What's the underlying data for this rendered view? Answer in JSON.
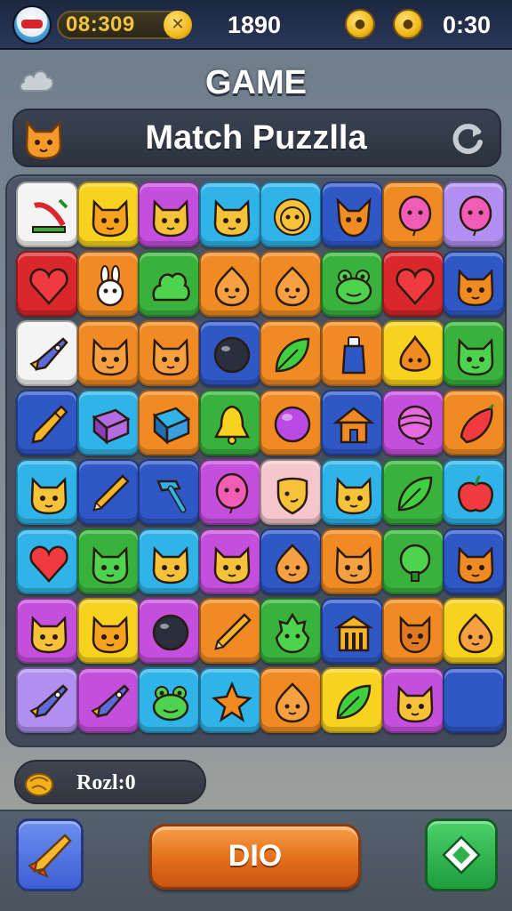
{
  "hud": {
    "coins": "08:309",
    "score": "1890",
    "timer": "0:30",
    "booster_1_icon": "gold-coin-icon",
    "booster_2_icon": "gold-coin-icon"
  },
  "header": {
    "title": "GAME",
    "subtitle": "Match Puzzlla"
  },
  "board": {
    "rows": 8,
    "cols": 8,
    "colors": {
      "white": "#f4f4f4",
      "yellow": "#f7d21f",
      "magenta": "#c44fdc",
      "cyan": "#2fb3e8",
      "blue": "#2f57c6",
      "orange": "#f08a22",
      "lavender": "#b08ff0",
      "red": "#d9272b",
      "green": "#38b23c",
      "pink": "#f5c6cb"
    },
    "tiles": [
      [
        {
          "c": "white",
          "i": "slide"
        },
        {
          "c": "yellow",
          "i": "cat"
        },
        {
          "c": "magenta",
          "i": "cat"
        },
        {
          "c": "cyan",
          "i": "cat"
        },
        {
          "c": "cyan",
          "i": "lion"
        },
        {
          "c": "blue",
          "i": "fox"
        },
        {
          "c": "orange",
          "i": "balloon"
        },
        {
          "c": "lavender",
          "i": "balloon"
        }
      ],
      [
        {
          "c": "red",
          "i": "heart"
        },
        {
          "c": "orange",
          "i": "bunny"
        },
        {
          "c": "green",
          "i": "bush"
        },
        {
          "c": "orange",
          "i": "blob"
        },
        {
          "c": "orange",
          "i": "blob"
        },
        {
          "c": "green",
          "i": "frog"
        },
        {
          "c": "red",
          "i": "heart"
        },
        {
          "c": "blue",
          "i": "cat"
        }
      ],
      [
        {
          "c": "white",
          "i": "rocket"
        },
        {
          "c": "orange",
          "i": "cat"
        },
        {
          "c": "orange",
          "i": "cat"
        },
        {
          "c": "blue",
          "i": "ball"
        },
        {
          "c": "orange",
          "i": "leaf"
        },
        {
          "c": "orange",
          "i": "bottle"
        },
        {
          "c": "yellow",
          "i": "onion"
        },
        {
          "c": "green",
          "i": "cat"
        }
      ],
      [
        {
          "c": "blue",
          "i": "crystal"
        },
        {
          "c": "cyan",
          "i": "book"
        },
        {
          "c": "orange",
          "i": "box"
        },
        {
          "c": "green",
          "i": "bell"
        },
        {
          "c": "orange",
          "i": "orb"
        },
        {
          "c": "blue",
          "i": "house"
        },
        {
          "c": "magenta",
          "i": "yarn"
        },
        {
          "c": "orange",
          "i": "chili"
        }
      ],
      [
        {
          "c": "cyan",
          "i": "cat"
        },
        {
          "c": "blue",
          "i": "pencil"
        },
        {
          "c": "blue",
          "i": "hammer"
        },
        {
          "c": "magenta",
          "i": "balloon"
        },
        {
          "c": "pink",
          "i": "shield"
        },
        {
          "c": "cyan",
          "i": "cat"
        },
        {
          "c": "green",
          "i": "leaf"
        },
        {
          "c": "cyan",
          "i": "apple"
        }
      ],
      [
        {
          "c": "cyan",
          "i": "heart"
        },
        {
          "c": "green",
          "i": "cat"
        },
        {
          "c": "cyan",
          "i": "cat"
        },
        {
          "c": "magenta",
          "i": "cat"
        },
        {
          "c": "blue",
          "i": "blob"
        },
        {
          "c": "orange",
          "i": "cat"
        },
        {
          "c": "green",
          "i": "tree"
        },
        {
          "c": "blue",
          "i": "cat"
        }
      ],
      [
        {
          "c": "magenta",
          "i": "cat"
        },
        {
          "c": "yellow",
          "i": "cat"
        },
        {
          "c": "magenta",
          "i": "ball"
        },
        {
          "c": "orange",
          "i": "pencil"
        },
        {
          "c": "green",
          "i": "dragon"
        },
        {
          "c": "blue",
          "i": "temple"
        },
        {
          "c": "orange",
          "i": "squirrel"
        },
        {
          "c": "yellow",
          "i": "blob"
        }
      ],
      [
        {
          "c": "lavender",
          "i": "rocket"
        },
        {
          "c": "magenta",
          "i": "rocket"
        },
        {
          "c": "cyan",
          "i": "frog"
        },
        {
          "c": "cyan",
          "i": "star"
        },
        {
          "c": "orange",
          "i": "blob"
        },
        {
          "c": "yellow",
          "i": "leaf"
        },
        {
          "c": "magenta",
          "i": "cat"
        },
        {
          "c": "blue",
          "i": "empty"
        }
      ]
    ]
  },
  "footer": {
    "info_icon": "lemon-icon",
    "info_value": "Rozl:0",
    "rocket_icon": "rocket-icon",
    "main_button": "DIO",
    "diamond_icon": "diamond-icon"
  }
}
